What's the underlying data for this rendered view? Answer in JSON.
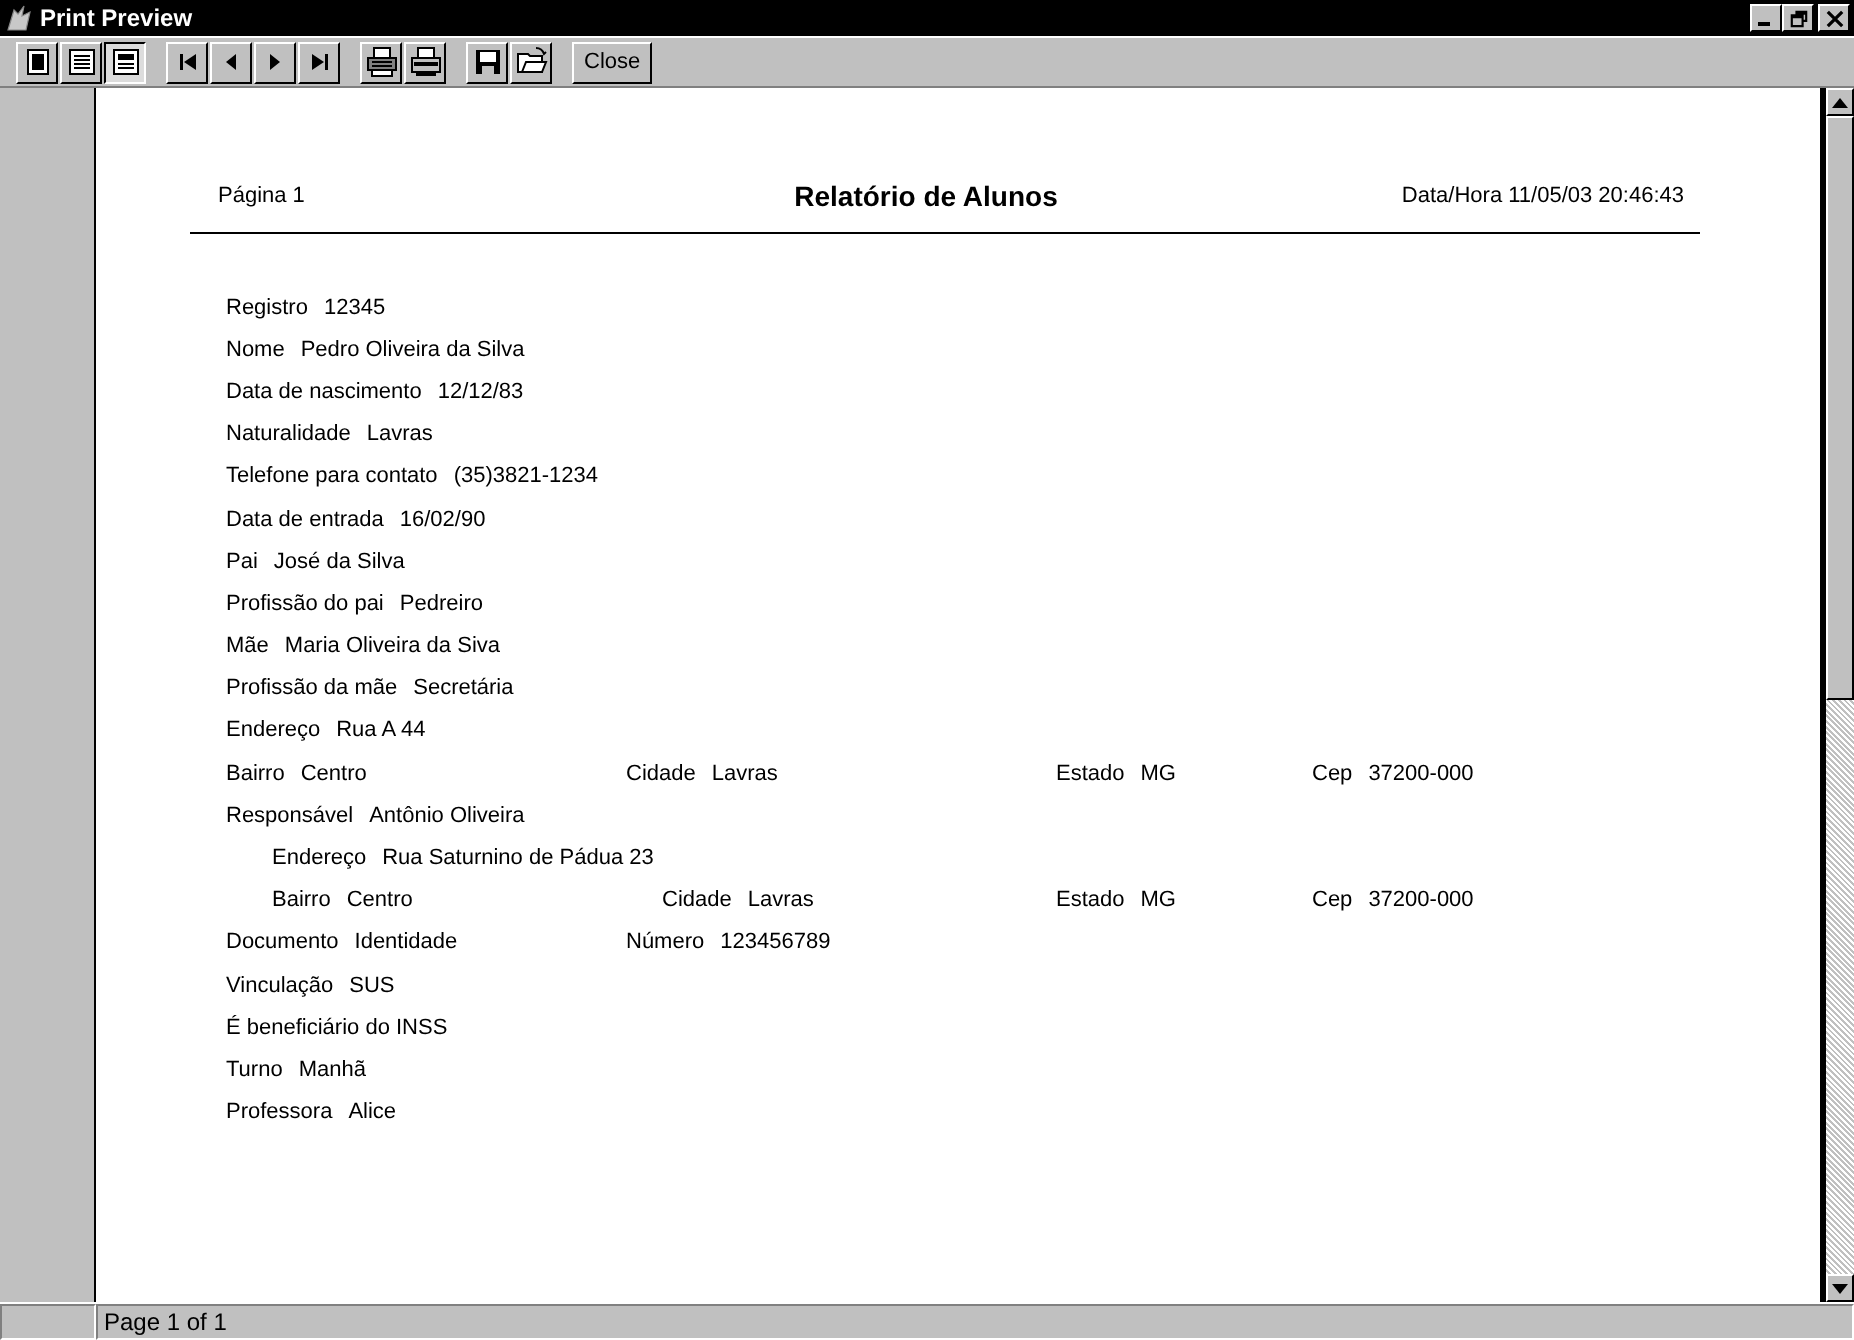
{
  "window": {
    "title": "Print Preview"
  },
  "toolbar": {
    "view_buttons": [
      {
        "selected": false
      },
      {
        "selected": false
      },
      {
        "selected": true
      }
    ],
    "close_label": "Close"
  },
  "report": {
    "page_label": "Página 1",
    "title": "Relatório de Alunos",
    "timestamp": "Data/Hora 11/05/03 20:46:43",
    "rows": [
      {
        "indented": false,
        "fields": [
          {
            "label": "Registro",
            "value": "12345"
          }
        ]
      },
      {
        "indented": false,
        "fields": [
          {
            "label": "Nome",
            "value": "Pedro Oliveira da Silva"
          }
        ]
      },
      {
        "indented": false,
        "fields": [
          {
            "label": "Data de nascimento",
            "value": "12/12/83"
          }
        ]
      },
      {
        "indented": false,
        "fields": [
          {
            "label": "Naturalidade",
            "value": "Lavras"
          }
        ]
      },
      {
        "indented": false,
        "fields": [
          {
            "label": "Telefone para contato",
            "value": "(35)3821-1234"
          }
        ]
      },
      {
        "indented": false,
        "fields": [
          {
            "label": "Data de entrada",
            "value": "16/02/90"
          }
        ]
      },
      {
        "indented": false,
        "fields": [
          {
            "label": "Pai",
            "value": "José da Silva"
          }
        ]
      },
      {
        "indented": false,
        "fields": [
          {
            "label": "Profissão do pai",
            "value": "Pedreiro"
          }
        ]
      },
      {
        "indented": false,
        "fields": [
          {
            "label": "Mãe",
            "value": "Maria Oliveira da Siva"
          }
        ]
      },
      {
        "indented": false,
        "fields": [
          {
            "label": "Profissão da mãe",
            "value": "Secretária"
          }
        ]
      },
      {
        "indented": false,
        "fields": [
          {
            "label": "Endereço",
            "value": "Rua A 44"
          }
        ]
      },
      {
        "indented": false,
        "fields": [
          {
            "label": "Bairro",
            "value": "Centro"
          },
          {
            "label": "Cidade",
            "value": "Lavras"
          },
          {
            "label": "Estado",
            "value": "MG"
          },
          {
            "label": "Cep",
            "value": "37200-000"
          }
        ]
      },
      {
        "indented": false,
        "fields": [
          {
            "label": "Responsável",
            "value": "Antônio Oliveira"
          }
        ]
      },
      {
        "indented": true,
        "fields": [
          {
            "label": "Endereço",
            "value": "Rua Saturnino de Pádua 23"
          }
        ]
      },
      {
        "indented": true,
        "fields": [
          {
            "label": "Bairro",
            "value": "Centro"
          },
          {
            "label": "Cidade",
            "value": "Lavras"
          },
          {
            "label": "Estado",
            "value": "MG"
          },
          {
            "label": "Cep",
            "value": "37200-000"
          }
        ]
      },
      {
        "indented": false,
        "fields": [
          {
            "label": "Documento",
            "value": "Identidade"
          },
          {
            "label": "Número",
            "value": "123456789"
          }
        ]
      },
      {
        "indented": false,
        "fields": [
          {
            "label": "Vinculação",
            "value": "SUS"
          }
        ]
      },
      {
        "indented": false,
        "fields": [
          {
            "label": "É beneficiário do INSS"
          }
        ]
      },
      {
        "indented": false,
        "fields": [
          {
            "label": "Turno",
            "value": "Manhã"
          }
        ]
      },
      {
        "indented": false,
        "fields": [
          {
            "label": "Professora",
            "value": "Alice"
          }
        ]
      }
    ]
  },
  "status_bar": {
    "text": "Page 1 of 1"
  }
}
